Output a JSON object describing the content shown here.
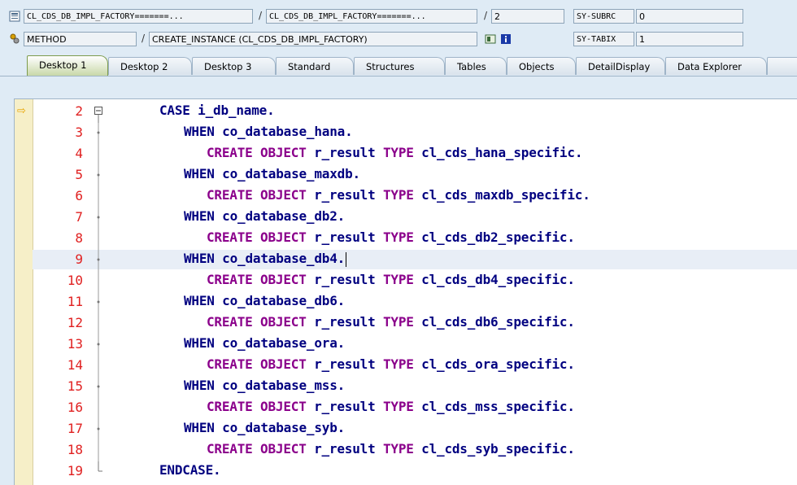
{
  "header": {
    "prog1": "CL_CDS_DB_IMPL_FACTORY=======...",
    "prog2": "CL_CDS_DB_IMPL_FACTORY=======...",
    "line_no": "2",
    "type": "METHOD",
    "event": "CREATE_INSTANCE (CL_CDS_DB_IMPL_FACTORY)",
    "sep": "/",
    "sys1_name": "SY-SUBRC",
    "sys1_value": "0",
    "sys2_name": "SY-TABIX",
    "sys2_value": "1"
  },
  "tabs": [
    "Desktop 1",
    "Desktop 2",
    "Desktop 3",
    "Standard",
    "Structures",
    "Tables",
    "Objects",
    "DetailDisplay",
    "Data Explorer"
  ],
  "code": {
    "lines": [
      {
        "n": "2",
        "indent": 0,
        "parts": [
          [
            "kw",
            "CASE "
          ],
          [
            "id",
            "i_db_name"
          ],
          [
            "kw",
            "."
          ]
        ]
      },
      {
        "n": "3",
        "indent": 1,
        "parts": [
          [
            "kw",
            "WHEN "
          ],
          [
            "id",
            "co_database_hana"
          ],
          [
            "kw",
            "."
          ]
        ]
      },
      {
        "n": "4",
        "indent": 2,
        "parts": [
          [
            "kw2",
            "CREATE OBJECT "
          ],
          [
            "id",
            "r_result "
          ],
          [
            "kw2",
            "TYPE "
          ],
          [
            "id",
            "cl_cds_hana_specific"
          ],
          [
            "kw",
            "."
          ]
        ]
      },
      {
        "n": "5",
        "indent": 1,
        "parts": [
          [
            "kw",
            "WHEN "
          ],
          [
            "id",
            "co_database_maxdb"
          ],
          [
            "kw",
            "."
          ]
        ]
      },
      {
        "n": "6",
        "indent": 2,
        "parts": [
          [
            "kw2",
            "CREATE OBJECT "
          ],
          [
            "id",
            "r_result "
          ],
          [
            "kw2",
            "TYPE "
          ],
          [
            "id",
            "cl_cds_maxdb_specific"
          ],
          [
            "kw",
            "."
          ]
        ]
      },
      {
        "n": "7",
        "indent": 1,
        "parts": [
          [
            "kw",
            "WHEN "
          ],
          [
            "id",
            "co_database_db2"
          ],
          [
            "kw",
            "."
          ]
        ]
      },
      {
        "n": "8",
        "indent": 2,
        "parts": [
          [
            "kw2",
            "CREATE OBJECT "
          ],
          [
            "id",
            "r_result "
          ],
          [
            "kw2",
            "TYPE "
          ],
          [
            "id",
            "cl_cds_db2_specific"
          ],
          [
            "kw",
            "."
          ]
        ]
      },
      {
        "n": "9",
        "indent": 1,
        "parts": [
          [
            "kw",
            "WHEN "
          ],
          [
            "id",
            "co_database_db4"
          ],
          [
            "kw",
            "."
          ]
        ]
      },
      {
        "n": "10",
        "indent": 2,
        "parts": [
          [
            "kw2",
            "CREATE OBJECT "
          ],
          [
            "id",
            "r_result "
          ],
          [
            "kw2",
            "TYPE "
          ],
          [
            "id",
            "cl_cds_db4_specific"
          ],
          [
            "kw",
            "."
          ]
        ]
      },
      {
        "n": "11",
        "indent": 1,
        "parts": [
          [
            "kw",
            "WHEN "
          ],
          [
            "id",
            "co_database_db6"
          ],
          [
            "kw",
            "."
          ]
        ]
      },
      {
        "n": "12",
        "indent": 2,
        "parts": [
          [
            "kw2",
            "CREATE OBJECT "
          ],
          [
            "id",
            "r_result "
          ],
          [
            "kw2",
            "TYPE "
          ],
          [
            "id",
            "cl_cds_db6_specific"
          ],
          [
            "kw",
            "."
          ]
        ]
      },
      {
        "n": "13",
        "indent": 1,
        "parts": [
          [
            "kw",
            "WHEN "
          ],
          [
            "id",
            "co_database_ora"
          ],
          [
            "kw",
            "."
          ]
        ]
      },
      {
        "n": "14",
        "indent": 2,
        "parts": [
          [
            "kw2",
            "CREATE OBJECT "
          ],
          [
            "id",
            "r_result "
          ],
          [
            "kw2",
            "TYPE "
          ],
          [
            "id",
            "cl_cds_ora_specific"
          ],
          [
            "kw",
            "."
          ]
        ]
      },
      {
        "n": "15",
        "indent": 1,
        "parts": [
          [
            "kw",
            "WHEN "
          ],
          [
            "id",
            "co_database_mss"
          ],
          [
            "kw",
            "."
          ]
        ]
      },
      {
        "n": "16",
        "indent": 2,
        "parts": [
          [
            "kw2",
            "CREATE OBJECT "
          ],
          [
            "id",
            "r_result "
          ],
          [
            "kw2",
            "TYPE "
          ],
          [
            "id",
            "cl_cds_mss_specific"
          ],
          [
            "kw",
            "."
          ]
        ]
      },
      {
        "n": "17",
        "indent": 1,
        "parts": [
          [
            "kw",
            "WHEN "
          ],
          [
            "id",
            "co_database_syb"
          ],
          [
            "kw",
            "."
          ]
        ]
      },
      {
        "n": "18",
        "indent": 2,
        "parts": [
          [
            "kw2",
            "CREATE OBJECT "
          ],
          [
            "id",
            "r_result "
          ],
          [
            "kw2",
            "TYPE "
          ],
          [
            "id",
            "cl_cds_syb_specific"
          ],
          [
            "kw",
            "."
          ]
        ]
      },
      {
        "n": "19",
        "indent": 0,
        "parts": [
          [
            "kw",
            "ENDCASE"
          ],
          [
            "kw",
            "."
          ]
        ]
      }
    ],
    "current_line": "9"
  }
}
